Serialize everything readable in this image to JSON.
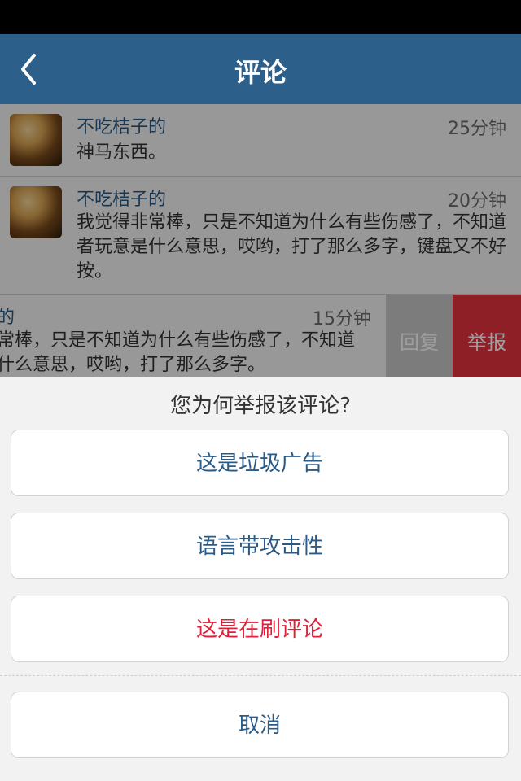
{
  "header": {
    "title": "评论"
  },
  "comments": [
    {
      "name": "不吃桔子的",
      "time": "25分钟",
      "text": "神马东西。"
    },
    {
      "name": "不吃桔子的",
      "time": "20分钟",
      "text": "我觉得非常棒，只是不知道为什么有些伤感了，不知道者玩意是什么意思，哎哟，打了那么多字，键盘又不好按。"
    }
  ],
  "swiped_comment": {
    "name": "不吃桔子的",
    "time": "15分钟",
    "text": "我觉得非常棒，只是不知道为什么有些伤感了，不知道这玩意是什么意思，哎哟，打了那么多字。",
    "reply_label": "回复",
    "report_label": "举报"
  },
  "report_sheet": {
    "question": "您为何举报该评论?",
    "options": [
      "这是垃圾广告",
      "语言带攻击性",
      "这是在刷评论"
    ],
    "cancel_label": "取消"
  },
  "colors": {
    "header": "#2d5f8b",
    "name_text": "#2a5a86",
    "report_button": "#e5333f",
    "danger_option": "#e0203a"
  },
  "icons": {
    "back": "chevron-left-icon",
    "avatar": "user-avatar"
  }
}
